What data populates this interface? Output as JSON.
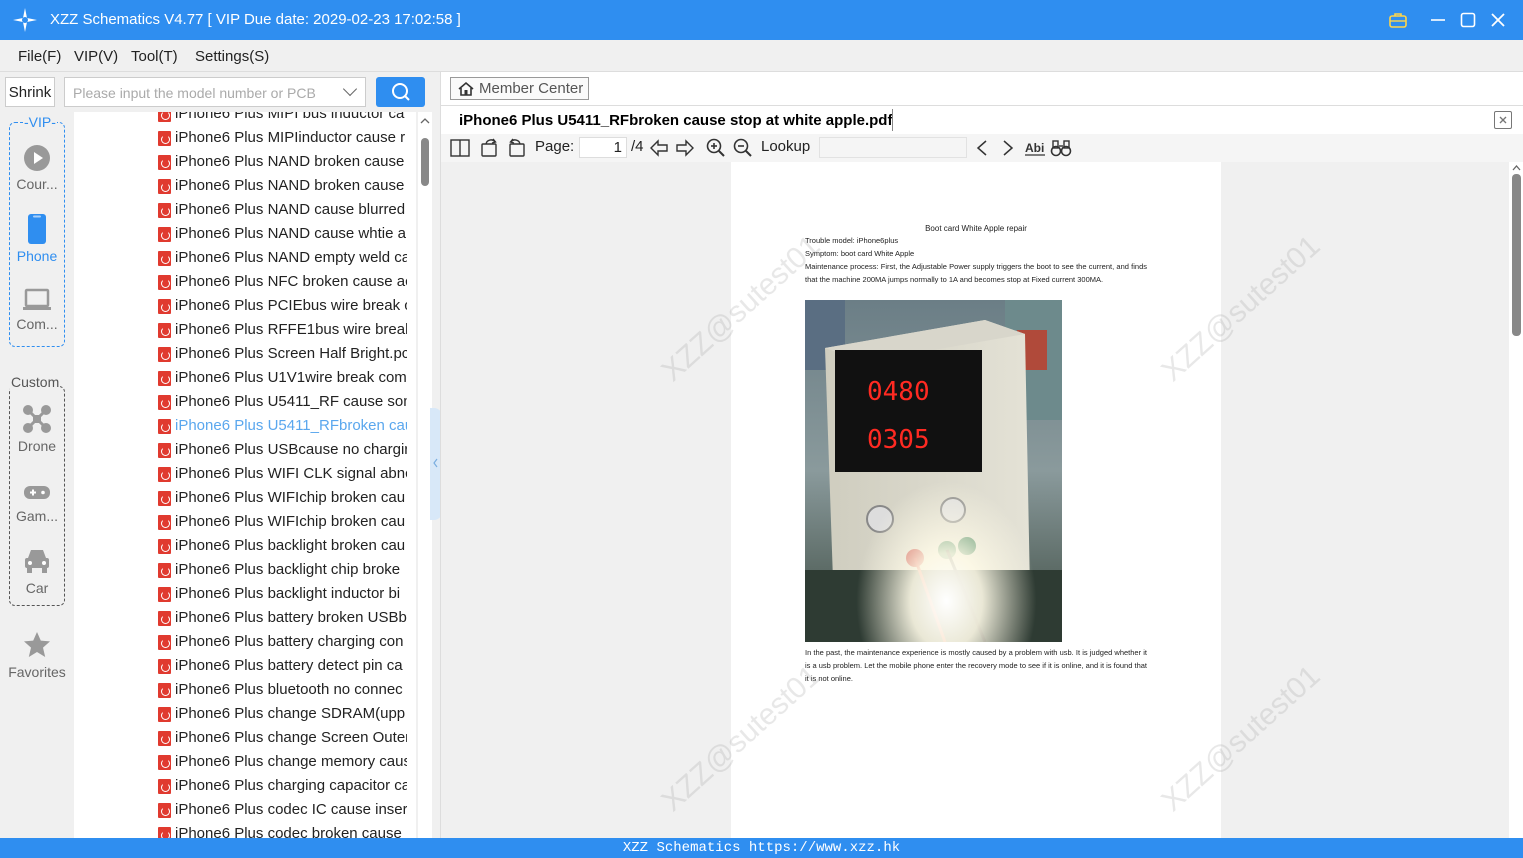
{
  "app": {
    "title": "XZZ Schematics V4.77 [ VIP Due date: 2029-02-23 17:02:58 ]",
    "colors": {
      "accent": "#2f8ef0",
      "pdf_icon": "#e03a2f",
      "selected_text": "#5aa7ee"
    }
  },
  "menu": [
    "File(F)",
    "VIP(V)",
    "Tool(T)",
    "Settings(S)"
  ],
  "sidebar": {
    "shrink_label": "Shrink",
    "search_placeholder": "Please input the model number or PCB",
    "vip_group_label": "-VIP-",
    "custom_group_label": "Custom",
    "categories": [
      {
        "label": "Cour...",
        "icon": "play-circle-icon"
      },
      {
        "label": "Phone",
        "icon": "phone-icon",
        "active": true
      },
      {
        "label": "Com...",
        "icon": "laptop-icon"
      },
      {
        "label": "Drone",
        "icon": "drone-icon"
      },
      {
        "label": "Gam...",
        "icon": "gamepad-icon"
      },
      {
        "label": "Car",
        "icon": "car-icon"
      },
      {
        "label": "Favorites",
        "icon": "star-icon"
      }
    ]
  },
  "files": [
    "iPhone6 Plus MIPI bus inductor ca",
    "iPhone6 Plus MIPIinductor cause r",
    "iPhone6 Plus NAND broken cause",
    "iPhone6 Plus NAND broken cause",
    "iPhone6 Plus NAND cause blurred",
    "iPhone6 Plus NAND cause whtie a",
    "iPhone6 Plus NAND empty weld ca",
    "iPhone6 Plus NFC broken cause ac",
    "iPhone6 Plus PCIEbus wire break c",
    "iPhone6 Plus RFFE1bus wire break",
    "iPhone6 Plus Screen Half Bright.pc",
    "iPhone6 Plus U1V1wire break com",
    "iPhone6 Plus U5411_RF cause som",
    "iPhone6 Plus U5411_RFbroken cau",
    "iPhone6 Plus USBcause no chargir",
    "iPhone6 Plus WIFI CLK signal abnc",
    "iPhone6 Plus WIFIchip broken cau",
    "iPhone6 Plus WIFIchip broken cau",
    "iPhone6 Plus backlight broken cau",
    "iPhone6 Plus backlight chip broke",
    "iPhone6 Plus backlight inductor bi",
    "iPhone6 Plus battery broken USBb",
    "iPhone6 Plus battery charging con",
    "iPhone6 Plus battery detect pin ca",
    "iPhone6 Plus bluetooth no connec",
    "iPhone6 Plus change SDRAM(upp",
    "iPhone6 Plus change Screen Outer",
    "iPhone6 Plus change memory caus",
    "iPhone6 Plus charging capacitor ca",
    "iPhone6 Plus codec IC cause insert",
    "iPhone6 Plus codec broken cause"
  ],
  "selected_file_index": 13,
  "main": {
    "member_center": "Member Center",
    "doc_tab": "iPhone6 Plus U5411_RFbroken cause stop at white apple.pdf",
    "page_label": "Page:",
    "page_value": "1",
    "page_total": "/4",
    "lookup_label": "Lookup"
  },
  "pdf": {
    "heading": "Boot card White Apple repair",
    "model_line": "Trouble model: iPhone6plus",
    "symptom_line": "Symptom: boot card White Apple",
    "process_line": "Maintenance process: First, the Adjustable Power supply triggers the boot to see the current, and finds that the machine 200MA jumps normally to 1A and becomes stop at Fixed current 300MA.",
    "after_photo": "In the past, the maintenance experience is mostly caused by a problem with usb. It is judged whether it is a usb problem. Let the mobile phone enter the recovery mode to see if it is online, and it is found that it is not online.",
    "readout_voltage": "0480",
    "readout_current": "0305",
    "watermark": "XZZ@sutest01"
  },
  "footer": "XZZ Schematics https://www.xzz.hk"
}
